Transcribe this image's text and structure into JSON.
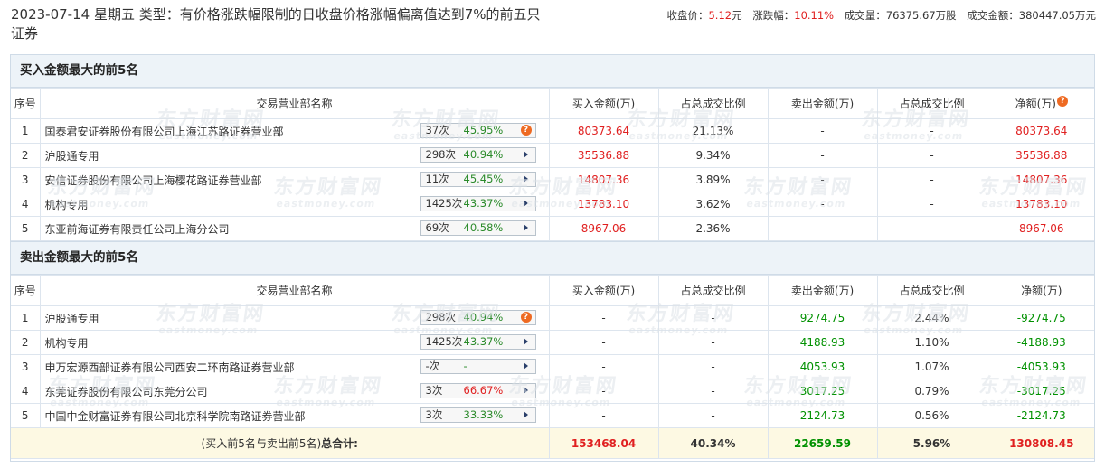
{
  "header": {
    "title": "2023-07-14 星期五 类型：有价格涨跌幅限制的日收盘价格涨幅偏离值达到7%的前五只证券",
    "close_label": "收盘价：",
    "close_value": "5.12",
    "close_unit": "元",
    "change_label": "涨跌幅：",
    "change_value": "10.11%",
    "volume_label": "成交量：",
    "volume_value": "76375.67万股",
    "amount_label": "成交金额：",
    "amount_value": "380447.05万元"
  },
  "columns": {
    "no": "序号",
    "name": "交易营业部名称",
    "buy": "买入金额(万)",
    "buy_ratio": "占总成交比例",
    "sell": "卖出金额(万)",
    "sell_ratio": "占总成交比例",
    "net": "净额(万)"
  },
  "watermark": {
    "cn": "东方财富网",
    "en": "eastmoney.com"
  },
  "question_icon": "?",
  "buy_section": {
    "title": "买入金额最大的前5名",
    "rows": [
      {
        "no": "1",
        "name": "国泰君安证券股份有限公司上海江苏路证券营业部",
        "count": "37次",
        "rate": "45.95%",
        "rate_color": "green",
        "icon": "question-icon",
        "buy": "80373.64",
        "buy_ratio": "21.13%",
        "sell": "-",
        "sell_ratio": "-",
        "net": "80373.64"
      },
      {
        "no": "2",
        "name": "沪股通专用",
        "count": "298次",
        "rate": "40.94%",
        "rate_color": "green",
        "icon": "arrow-right-icon",
        "buy": "35536.88",
        "buy_ratio": "9.34%",
        "sell": "-",
        "sell_ratio": "-",
        "net": "35536.88"
      },
      {
        "no": "3",
        "name": "安信证券股份有限公司上海樱花路证券营业部",
        "count": "11次",
        "rate": "45.45%",
        "rate_color": "green",
        "icon": "arrow-right-icon",
        "buy": "14807.36",
        "buy_ratio": "3.89%",
        "sell": "-",
        "sell_ratio": "-",
        "net": "14807.36"
      },
      {
        "no": "4",
        "name": "机构专用",
        "count": "1425次",
        "rate": "43.37%",
        "rate_color": "green",
        "icon": "arrow-right-icon",
        "buy": "13783.10",
        "buy_ratio": "3.62%",
        "sell": "-",
        "sell_ratio": "-",
        "net": "13783.10"
      },
      {
        "no": "5",
        "name": "东亚前海证券有限责任公司上海分公司",
        "count": "69次",
        "rate": "40.58%",
        "rate_color": "green",
        "icon": "arrow-right-icon",
        "buy": "8967.06",
        "buy_ratio": "2.36%",
        "sell": "-",
        "sell_ratio": "-",
        "net": "8967.06"
      }
    ]
  },
  "sell_section": {
    "title": "卖出金额最大的前5名",
    "rows": [
      {
        "no": "1",
        "name": "沪股通专用",
        "count": "298次",
        "rate": "40.94%",
        "rate_color": "green",
        "icon": "question-icon",
        "buy": "-",
        "buy_ratio": "-",
        "sell": "9274.75",
        "sell_ratio": "2.44%",
        "net": "-9274.75"
      },
      {
        "no": "2",
        "name": "机构专用",
        "count": "1425次",
        "rate": "43.37%",
        "rate_color": "green",
        "icon": "arrow-right-icon",
        "buy": "-",
        "buy_ratio": "-",
        "sell": "4188.93",
        "sell_ratio": "1.10%",
        "net": "-4188.93"
      },
      {
        "no": "3",
        "name": "申万宏源西部证券有限公司西安二环南路证券营业部",
        "count": "-次",
        "rate": "-",
        "rate_color": "green",
        "icon": "arrow-right-icon",
        "buy": "-",
        "buy_ratio": "-",
        "sell": "4053.93",
        "sell_ratio": "1.07%",
        "net": "-4053.93"
      },
      {
        "no": "4",
        "name": "东莞证券股份有限公司东莞分公司",
        "count": "3次",
        "rate": "66.67%",
        "rate_color": "red",
        "icon": "arrow-right-icon",
        "buy": "-",
        "buy_ratio": "-",
        "sell": "3017.25",
        "sell_ratio": "0.79%",
        "net": "-3017.25"
      },
      {
        "no": "5",
        "name": "中国中金财富证券有限公司北京科学院南路证券营业部",
        "count": "3次",
        "rate": "33.33%",
        "rate_color": "green",
        "icon": "arrow-right-icon",
        "buy": "-",
        "buy_ratio": "-",
        "sell": "2124.73",
        "sell_ratio": "0.56%",
        "net": "-2124.73"
      }
    ]
  },
  "total": {
    "label_prefix": "(买入前5名与卖出前5名)",
    "label_bold": "总合计:",
    "buy": "153468.04",
    "buy_ratio": "40.34%",
    "sell": "22659.59",
    "sell_ratio": "5.96%",
    "net": "130808.45"
  },
  "colors": {
    "up": "#e02020",
    "down": "#009100",
    "header_bg": "#edf3f8",
    "total_bg": "#fdf9e3",
    "icon_orange": "#ee6a22"
  }
}
